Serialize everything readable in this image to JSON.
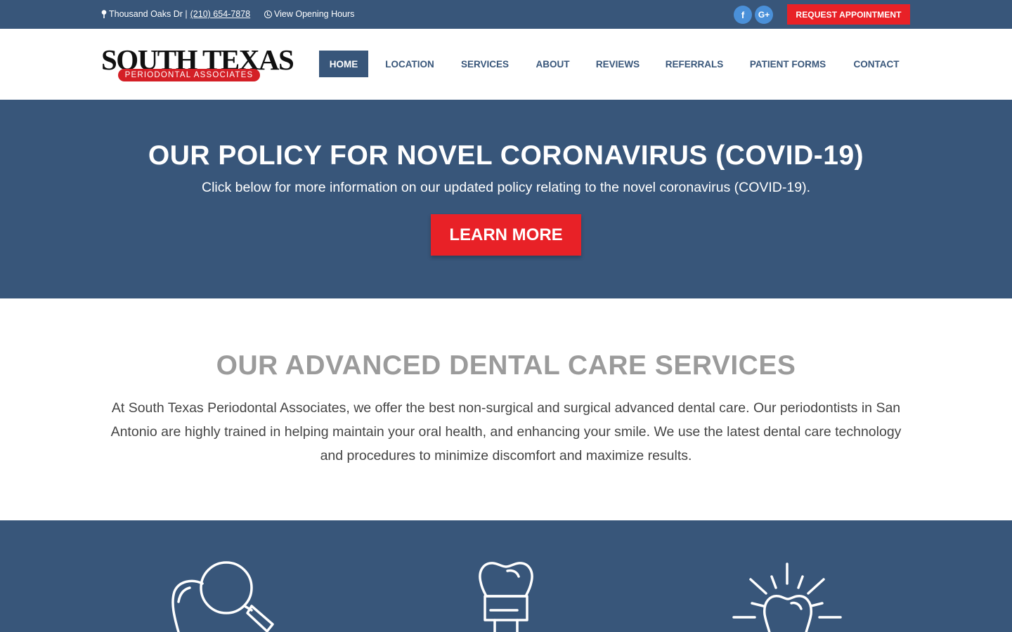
{
  "topbar": {
    "address": "Thousand Oaks Dr |",
    "phone": "(210) 654-7878",
    "hours_link": "View Opening Hours",
    "social": [
      {
        "name": "facebook",
        "glyph": "f"
      },
      {
        "name": "google-plus",
        "glyph": "G+"
      }
    ],
    "request_button": "REQUEST APPOINTMENT"
  },
  "logo": {
    "line1": "SOUTH TEXAS",
    "line2": "PERIODONTAL ASSOCIATES"
  },
  "nav": [
    {
      "label": "HOME",
      "active": true
    },
    {
      "label": "LOCATION"
    },
    {
      "label": "SERVICES"
    },
    {
      "label": "ABOUT"
    },
    {
      "label": "REVIEWS"
    },
    {
      "label": "REFERRALS"
    },
    {
      "label": "PATIENT FORMS"
    },
    {
      "label": "CONTACT"
    }
  ],
  "covid": {
    "title": "OUR POLICY FOR NOVEL CORONAVIRUS (COVID-19)",
    "subtitle": "Click below for more information on our updated policy relating to the novel coronavirus (COVID-19).",
    "button": "LEARN MORE"
  },
  "services": {
    "title": "OUR ADVANCED DENTAL CARE SERVICES",
    "body": "At South Texas Periodontal Associates, we offer the best non-surgical and surgical advanced dental care. Our periodontists in San Antonio are highly trained in helping maintain your oral health, and enhancing your smile. We use the latest dental care technology and procedures to minimize discomfort and maximize results."
  },
  "icons": [
    "tooth-magnifier-icon",
    "dental-crown-icon",
    "shining-tooth-icon"
  ],
  "colors": {
    "primary": "#38567a",
    "accent": "#e82127",
    "social": "#4a90d9",
    "heading_gray": "#9b9b9b"
  }
}
